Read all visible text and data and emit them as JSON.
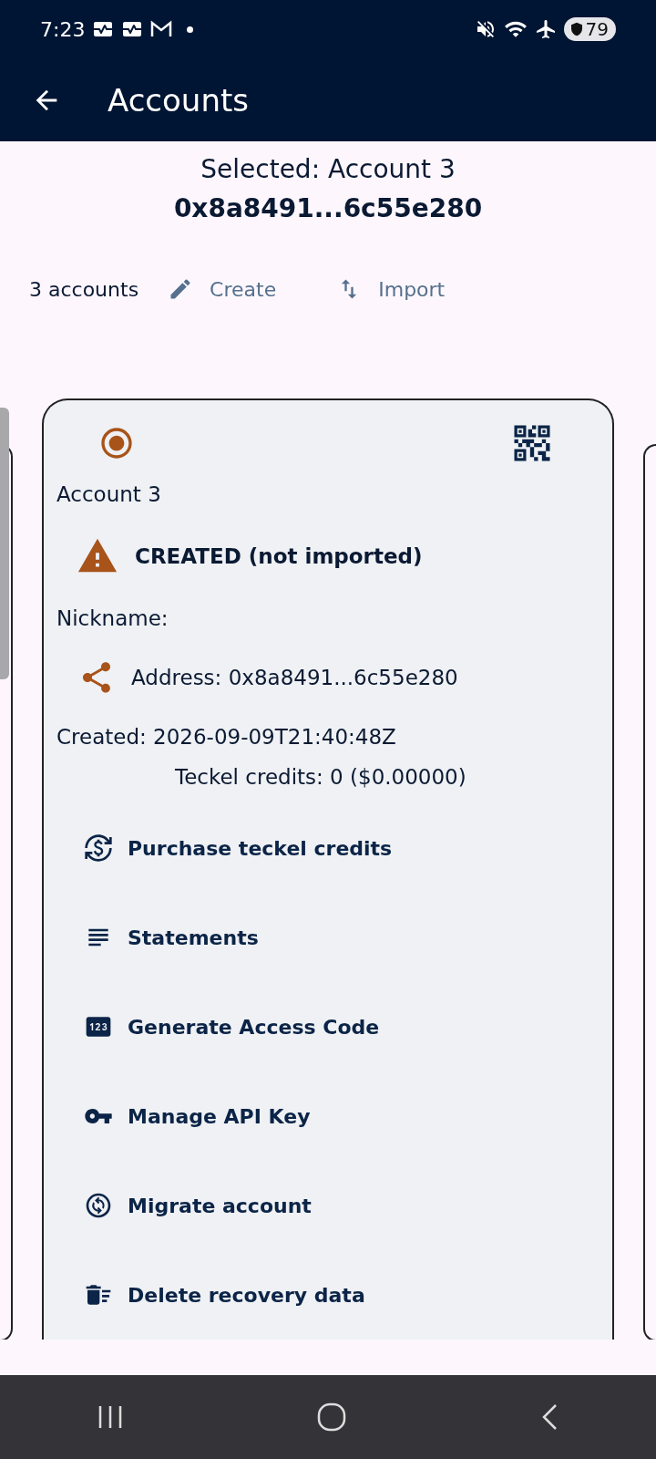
{
  "status_bar": {
    "time": "7:23",
    "battery": "79"
  },
  "app_bar": {
    "title": "Accounts"
  },
  "selected": {
    "label": "Selected: Account 3",
    "address": "0x8a8491...6c55e280"
  },
  "toolbar": {
    "count": "3 accounts",
    "buttons": [
      {
        "kind": "create",
        "label": "Create"
      },
      {
        "kind": "import",
        "label": "Import"
      }
    ]
  },
  "card": {
    "selected": true,
    "name": "Account 3",
    "status": "CREATED (not imported)",
    "nickname": "Nickname:",
    "address": "Address: 0x8a8491...6c55e280",
    "created": "Created: 2026-09-09T21:40:48Z",
    "credits": "Teckel credits: 0 ($0.00000)",
    "actions": [
      {
        "kind": "purchase",
        "label": "Purchase teckel credits"
      },
      {
        "kind": "statements",
        "label": "Statements"
      },
      {
        "kind": "code",
        "label": "Generate Access Code"
      },
      {
        "kind": "key",
        "label": "Manage API Key"
      },
      {
        "kind": "migrate",
        "label": "Migrate account"
      },
      {
        "kind": "delete",
        "label": "Delete recovery data"
      }
    ]
  }
}
